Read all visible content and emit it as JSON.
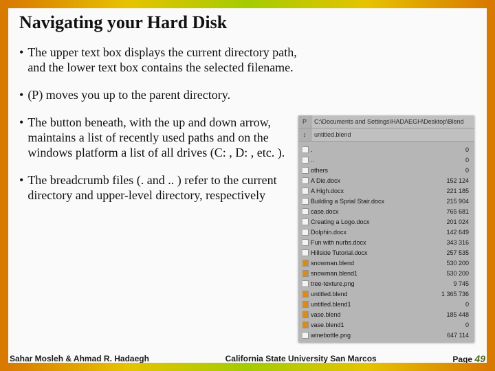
{
  "heading": "Navigating your Hard Disk",
  "bullets": [
    "The upper text box displays the current directory path, and the lower text box contains the selected filename.",
    "(P) moves you up to the parent directory.",
    "The button beneath, with the up and down arrow, maintains a list of recently used paths and on the windows platform a list of all drives (C: , D: , etc. ).",
    "The breadcrumb files (. and .. ) refer to the current directory and upper-level directory, respectively"
  ],
  "panel": {
    "top_button_1": "P",
    "path": "C:\\Documents and Settings\\HADAEGH\\Desktop\\Blend",
    "top_button_2": "↕",
    "filename": "untitled.blend",
    "rows": [
      {
        "icon": "white",
        "name": ".",
        "size": "0"
      },
      {
        "icon": "white",
        "name": "..",
        "size": "0"
      },
      {
        "icon": "white",
        "name": "others",
        "size": "0"
      },
      {
        "icon": "white",
        "name": "A Die.docx",
        "size": "152 124"
      },
      {
        "icon": "white",
        "name": "A High.docx",
        "size": "221 185"
      },
      {
        "icon": "white",
        "name": "Building a Sprial Stair.docx",
        "size": "215 904"
      },
      {
        "icon": "white",
        "name": "case.docx",
        "size": "765 681"
      },
      {
        "icon": "white",
        "name": "Creating a Logo.docx",
        "size": "201 024"
      },
      {
        "icon": "white",
        "name": "Dolphin.docx",
        "size": "142 649"
      },
      {
        "icon": "white",
        "name": "Fun with nurbs.docx",
        "size": "343 316"
      },
      {
        "icon": "white",
        "name": "Hillside Tutorial.docx",
        "size": "257 535"
      },
      {
        "icon": "orange",
        "name": "snowman.blend",
        "size": "530 200"
      },
      {
        "icon": "orange",
        "name": "snowman.blend1",
        "size": "530 200"
      },
      {
        "icon": "white",
        "name": "tree-texture.png",
        "size": "9 745"
      },
      {
        "icon": "orange",
        "name": "untitled.blend",
        "size": "1 365 736"
      },
      {
        "icon": "orange",
        "name": "untitled.blend1",
        "size": "0"
      },
      {
        "icon": "orange",
        "name": "vase.blend",
        "size": "185 448"
      },
      {
        "icon": "orange",
        "name": "vase.blend1",
        "size": "0"
      },
      {
        "icon": "white",
        "name": "winebottle.png",
        "size": "647 114"
      }
    ]
  },
  "footer": {
    "left": "Sahar Mosleh & Ahmad R. Hadaegh",
    "center": "California State University San Marcos",
    "page_label": "Page",
    "page_num": "49"
  }
}
